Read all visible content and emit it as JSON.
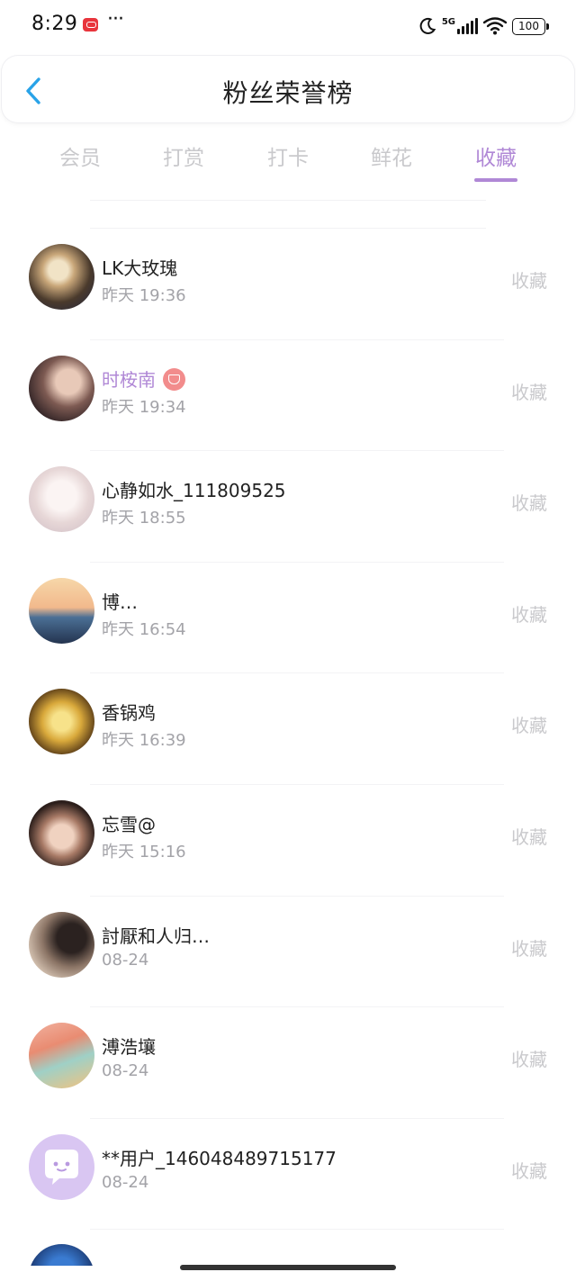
{
  "status_bar": {
    "time": "8:29",
    "more_indicator": "···",
    "network": "5G",
    "battery": "100",
    "icons": [
      "app-notification-icon",
      "moon-icon",
      "signal-icon",
      "wifi-icon",
      "battery-icon"
    ]
  },
  "header": {
    "back_icon": "chevron-left-icon",
    "title": "粉丝荣誉榜",
    "accent_color": "#29a3e8"
  },
  "tabs": {
    "active_color": "#b088d6",
    "inactive_color": "#c9c9cc",
    "items": [
      {
        "label": "会员",
        "active": false
      },
      {
        "label": "打赏",
        "active": false
      },
      {
        "label": "打卡",
        "active": false
      },
      {
        "label": "鲜花",
        "active": false
      },
      {
        "label": "收藏",
        "active": true
      }
    ]
  },
  "list": {
    "items": [
      {
        "name": "LK大玫瑰",
        "time": "昨天 19:36",
        "action": "收藏",
        "highlight": false,
        "badge": false,
        "avatar": "photo-avatar"
      },
      {
        "name": "时桉南",
        "time": "昨天 19:34",
        "action": "收藏",
        "highlight": true,
        "badge": true,
        "avatar": "photo-avatar"
      },
      {
        "name": "心静如水_111809525",
        "time": "昨天 18:55",
        "action": "收藏",
        "highlight": false,
        "badge": false,
        "avatar": "photo-avatar"
      },
      {
        "name": "博…",
        "time": "昨天 16:54",
        "action": "收藏",
        "highlight": false,
        "badge": false,
        "avatar": "photo-avatar"
      },
      {
        "name": "香锅鸡",
        "time": "昨天 16:39",
        "action": "收藏",
        "highlight": false,
        "badge": false,
        "avatar": "photo-avatar"
      },
      {
        "name": "忘雪@",
        "time": "昨天 15:16",
        "action": "收藏",
        "highlight": false,
        "badge": false,
        "avatar": "photo-avatar"
      },
      {
        "name": "討厭和人归…",
        "time": "08-24",
        "action": "收藏",
        "highlight": false,
        "badge": false,
        "avatar": "photo-avatar"
      },
      {
        "name": "溥浩壤",
        "time": "08-24",
        "action": "收藏",
        "highlight": false,
        "badge": false,
        "avatar": "photo-avatar"
      },
      {
        "name": "**用户_146048489715177",
        "time": "08-24",
        "action": "收藏",
        "highlight": false,
        "badge": false,
        "avatar": "chat-bubble-avatar-icon"
      }
    ]
  }
}
